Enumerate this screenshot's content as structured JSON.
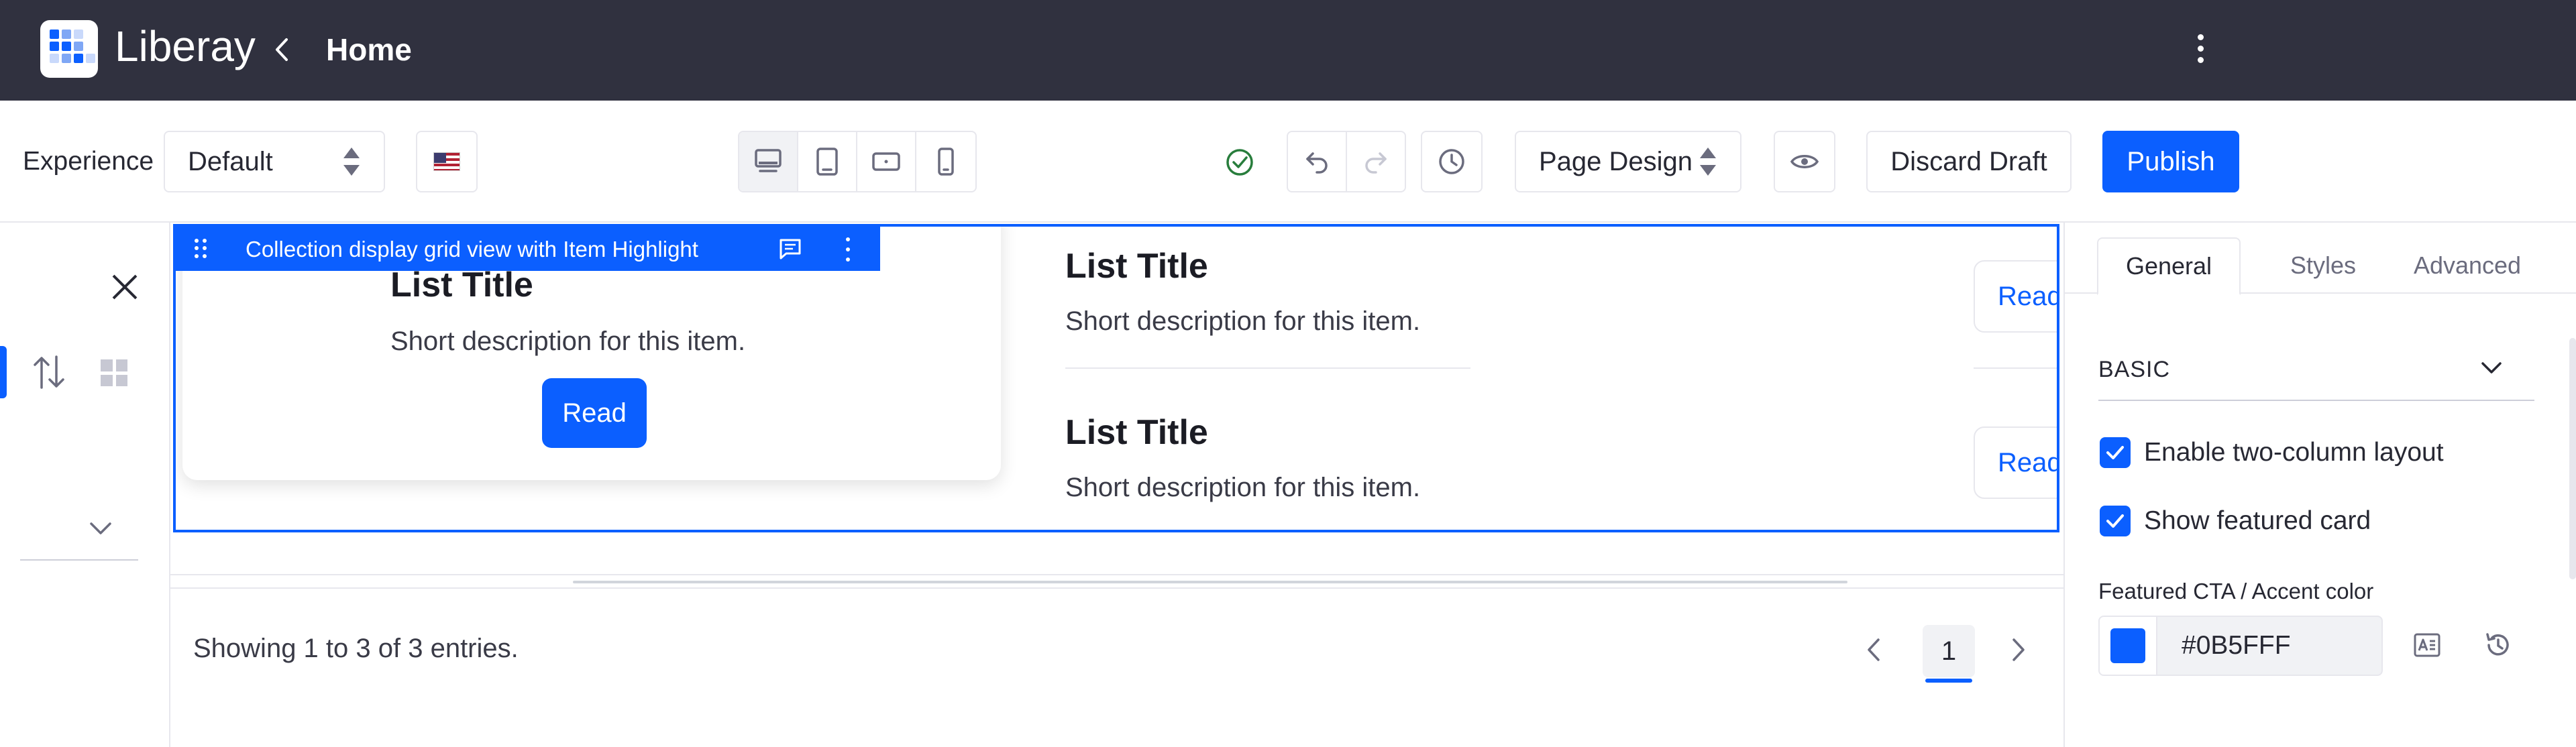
{
  "app": {
    "brand": "Liberay",
    "breadcrumb": "Home"
  },
  "colors": {
    "topbar": "#30313f",
    "accent": "#0b5fff",
    "success": "#287d3c"
  },
  "toolbar": {
    "experience_label": "Experience",
    "experience_value": "Default",
    "locale_icon": "flag-us-icon",
    "viewports": [
      "desktop",
      "tablet",
      "landscape",
      "portrait"
    ],
    "page_design": "Page Design",
    "discard": "Discard Draft",
    "publish": "Publish"
  },
  "fragment": {
    "label": "Collection display grid view with Item Highlight",
    "featured": {
      "title": "List Title",
      "description": "Short description for this item.",
      "cta": "Read"
    },
    "items": [
      {
        "title": "List Title",
        "description": "Short description for this item.",
        "cta": "Read"
      },
      {
        "title": "List Title",
        "description": "Short description for this item.",
        "cta": "Read"
      }
    ]
  },
  "pagination": {
    "summary": "Showing 1 to 3 of 3 entries.",
    "current": "1"
  },
  "panel": {
    "tabs": [
      "General",
      "Styles",
      "Advanced"
    ],
    "section": "BASIC",
    "options": [
      {
        "label": "Enable two-column layout",
        "checked": true
      },
      {
        "label": "Show featured card",
        "checked": true
      }
    ],
    "color_label": "Featured CTA / Accent color",
    "color_value": "#0B5FFF"
  }
}
